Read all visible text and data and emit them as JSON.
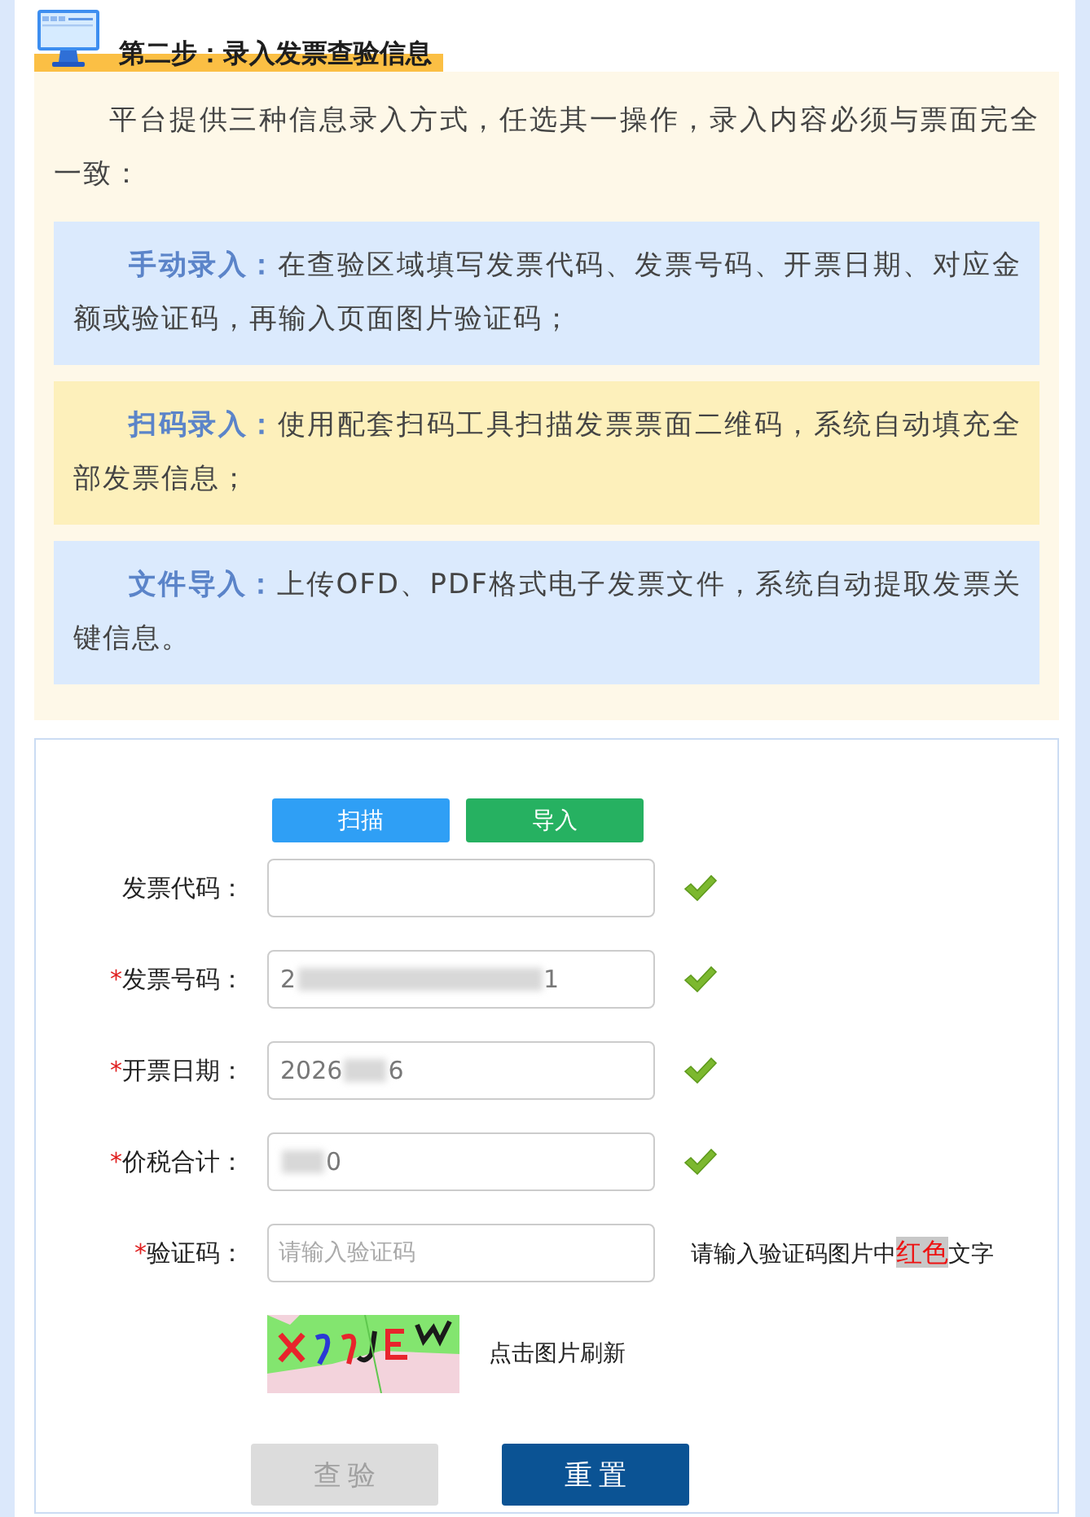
{
  "heading": {
    "title": "第二步：录入发票查验信息"
  },
  "intro": "平台提供三种信息录入方式，任选其一操作，录入内容必须与票面完全一致：",
  "methods": [
    {
      "text": "**手动录入：**在查验区域填写发票代码、发票号码、开票日期、对应金额或验证码，再输入页面图片验证码；",
      "color": "#dbeafd"
    },
    {
      "text": "**扫码录入：**使用配套扫码工具扫描发票票面二维码，系统自动填充全部发票信息；",
      "color": "#fdf0bb"
    },
    {
      "text": "**文件导入：**上传OFD、PDF格式电子发票文件，系统自动提取发票关键信息。",
      "color": "#dbeafd"
    }
  ],
  "form": {
    "actions": [
      {
        "label": "扫描",
        "color": "#2f9ff5"
      },
      {
        "label": "导入",
        "color": "#26b161"
      }
    ],
    "fields": [
      {
        "label": "发票代码：",
        "valid": true
      },
      {
        "marker": "*",
        "label": "发票号码：",
        "value_parts": [
          {
            "kind": "text",
            "text": "2"
          },
          {
            "kind": "longblur"
          },
          {
            "kind": "text",
            "text": "1"
          }
        ],
        "valid": true
      },
      {
        "marker": "*",
        "label": "开票日期：",
        "value_parts": [
          {
            "kind": "text",
            "text": "2026"
          },
          {
            "kind": "blur"
          },
          {
            "kind": "text",
            "text": "6"
          }
        ],
        "valid": true
      },
      {
        "marker": "*",
        "label": "价税合计：",
        "value_parts": [
          {
            "kind": "blur"
          },
          {
            "kind": "text",
            "text": "0"
          }
        ],
        "valid": true
      },
      {
        "marker": "*",
        "label": "验证码：",
        "placeholder": "请输入验证码",
        "hint": {
          "before": "请输入验证码图片中",
          "highlight": "红色",
          "after": "文字"
        }
      }
    ],
    "captcha": {
      "caption": "点击图片刷新"
    },
    "buttons": [
      {
        "label": "查验",
        "kind": "submit",
        "disabled": true
      },
      {
        "label": "重置",
        "kind": "reset",
        "disabled": false
      }
    ]
  }
}
